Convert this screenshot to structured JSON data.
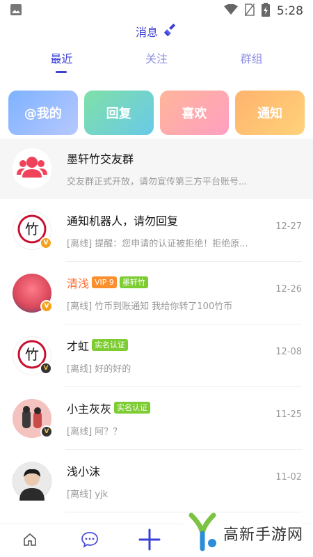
{
  "status_bar": {
    "time": "5:28"
  },
  "header": {
    "title": "消息"
  },
  "tabs": [
    {
      "label": "最近",
      "active": true
    },
    {
      "label": "关注",
      "active": false
    },
    {
      "label": "群组",
      "active": false
    }
  ],
  "quick_actions": [
    {
      "label": "@我的"
    },
    {
      "label": "回复"
    },
    {
      "label": "喜欢"
    },
    {
      "label": "通知"
    }
  ],
  "group": {
    "name": "墨轩竹交友群",
    "preview": "交友群正式开放，请勿宣传第三方平台账号..."
  },
  "messages": [
    {
      "name": "通知机器人，请勿回复",
      "preview": "[离线] 提醒：您申请的认证被拒绝！拒绝原...",
      "date": "12-27"
    },
    {
      "name": "清浅",
      "tag_vip": "VIP 9",
      "tag_group": "墨轩竹",
      "preview": "[离线] 竹币到账通知 我给你转了100竹币",
      "date": "12-26"
    },
    {
      "name": "才虹",
      "tag_auth": "实名认证",
      "preview": "[离线] 好的好的",
      "date": "12-08"
    },
    {
      "name": "小主灰灰",
      "tag_auth": "实名认证",
      "preview": "[离线] 阿？？",
      "date": "11-25"
    },
    {
      "name": "浅小沫",
      "preview": "[离线] yjk",
      "date": "11-02"
    }
  ],
  "watermark": {
    "text": "高新手游网"
  },
  "colors": {
    "accent": "#3b3fd6",
    "vip": "#fb8e2d",
    "auth": "#7ccc32",
    "name_highlight": "#ff6a2c"
  },
  "icons": [
    "image-icon",
    "wifi-icon",
    "no-sim-icon",
    "battery-icon",
    "broom-icon",
    "group-icon",
    "bamboo-logo-icon",
    "home-icon",
    "chat-icon",
    "plus-icon",
    "watermark-logo-icon"
  ]
}
